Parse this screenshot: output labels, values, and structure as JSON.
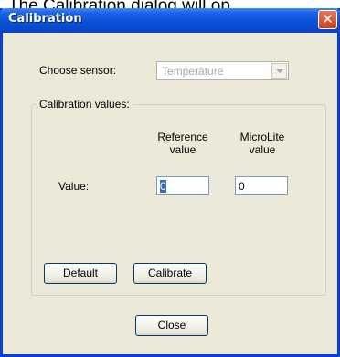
{
  "caption": "The Calibration dialog will op",
  "window": {
    "title": "Calibration",
    "close_symbol": "✕"
  },
  "sensor": {
    "label": "Choose sensor:",
    "selected": "Temperature"
  },
  "group": {
    "legend": "Calibration values:"
  },
  "columns": {
    "reference": "Reference\nvalue",
    "microlite": "MicroLite\nvalue"
  },
  "row": {
    "label": "Value:",
    "reference_value": "0",
    "microlite_value": "0"
  },
  "buttons": {
    "default": "Default",
    "calibrate": "Calibrate",
    "close": "Close"
  }
}
